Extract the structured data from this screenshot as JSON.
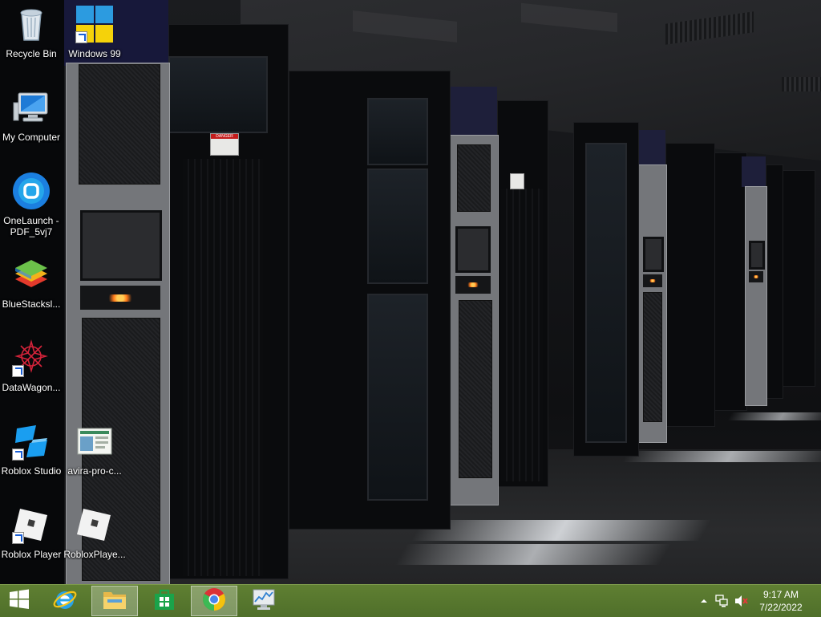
{
  "desktop": {
    "icons": [
      {
        "label": "Recycle Bin"
      },
      {
        "label": "Windows 99"
      },
      {
        "label": "My Computer"
      },
      {
        "label": "OneLaunch - PDF_5vj7"
      },
      {
        "label": "BlueStacksl..."
      },
      {
        "label": "DataWagon..."
      },
      {
        "label": "Roblox Studio"
      },
      {
        "label": "avira-pro-c..."
      },
      {
        "label": "Roblox Player"
      },
      {
        "label": "RobloxPlaye..."
      }
    ],
    "wallpaper": {
      "sign_text": "DANGER"
    }
  },
  "taskbar": {
    "buttons": [
      {
        "name": "start-button",
        "icon": "windows-logo-icon"
      },
      {
        "name": "internet-explorer-button",
        "icon": "internet-explorer-icon"
      },
      {
        "name": "file-explorer-button",
        "icon": "folder-icon"
      },
      {
        "name": "store-button",
        "icon": "store-icon"
      },
      {
        "name": "chrome-button",
        "icon": "chrome-icon"
      },
      {
        "name": "performance-monitor-button",
        "icon": "monitor-chart-icon"
      }
    ],
    "tray": {
      "time": "9:17 AM",
      "date": "7/22/2022",
      "icons": [
        "show-hidden-icons-chevron",
        "network-icon",
        "volume-muted-icon"
      ]
    },
    "colors": {
      "bar": "#587a2f",
      "active": "#8fa96a"
    }
  }
}
